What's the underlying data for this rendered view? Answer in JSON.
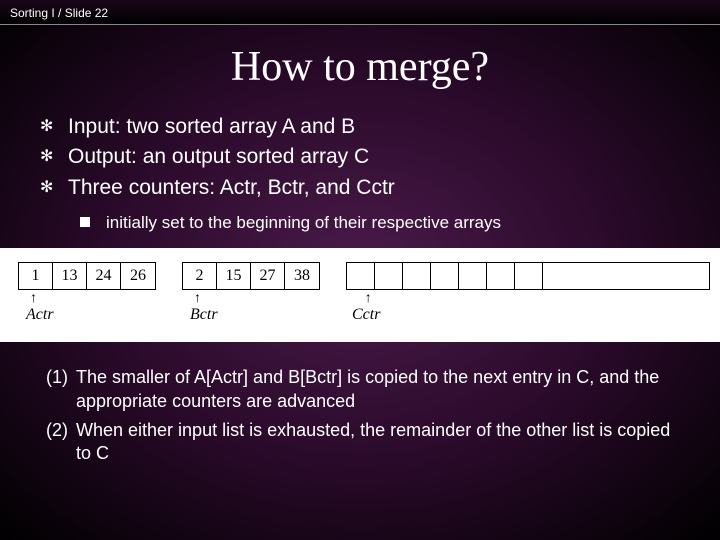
{
  "header": {
    "course": "Sorting I",
    "sep": "/",
    "slide": "Slide 22"
  },
  "title": "How to merge?",
  "bullets": [
    "Input: two sorted array A and B",
    "Output: an output sorted array C",
    "Three counters: Actr, Bctr, and Cctr"
  ],
  "subbullet": "initially set to the beginning of their respective arrays",
  "chart_data": {
    "type": "table",
    "arrays": [
      {
        "name": "A",
        "values": [
          1,
          13,
          24,
          26
        ],
        "pointer": "Actr",
        "pointer_index": 0
      },
      {
        "name": "B",
        "values": [
          2,
          15,
          27,
          38
        ],
        "pointer": "Bctr",
        "pointer_index": 0
      },
      {
        "name": "C",
        "values": [
          null,
          null,
          null,
          null,
          null,
          null,
          null,
          null
        ],
        "pointer": "Cctr",
        "pointer_index": 0
      }
    ]
  },
  "steps": [
    {
      "num": "(1)",
      "text": "The smaller of A[Actr] and B[Bctr] is copied to the next entry in C, and the appropriate counters are advanced"
    },
    {
      "num": "(2)",
      "text": "When either input list is exhausted, the remainder of the other list is copied to C"
    }
  ]
}
